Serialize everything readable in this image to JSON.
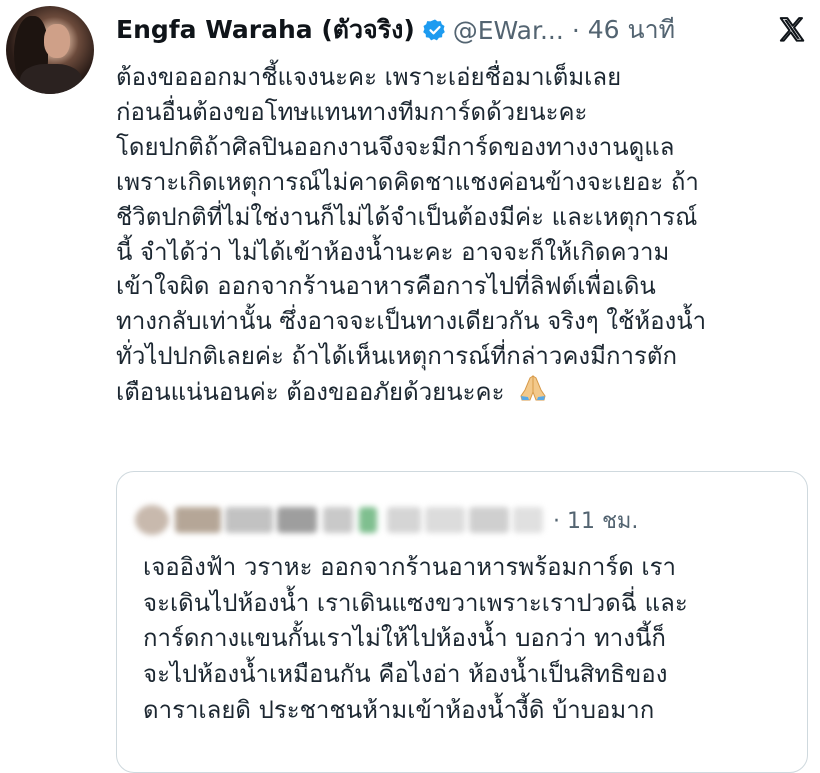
{
  "tweet": {
    "author_name": "Engfa Waraha (ตัวจริง)",
    "handle": "@EWar...",
    "separator": "·",
    "time": "46 นาที",
    "lines": [
      "ต้องขอออกมาชี้แจงนะคะ เพราะเอ่ยชื่อมาเต็มเลย",
      "ก่อนอื่นต้องขอโทษแทนทางทีมการ์ดด้วยนะคะ",
      "โดยปกติถ้าศิลปินออกงานจึงจะมีการ์ดของทางงานดูแล",
      "เพราะเกิดเหตุการณ์ไม่คาดคิดชาแชงค่อนข้างจะเยอะ ถ้า",
      "ชีวิตปกติที่ไม่ใช่งานก็ไม่ได้จำเป็นต้องมีค่ะ และเหตุการณ์",
      "นี้ จำได้ว่า ไม่ได้เข้าห้องน้ำนะคะ อาจจะก็ให้เกิดความ",
      "เข้าใจผิด  ออกจากร้านอาหารคือการไปที่ลิฟต์เพื่อเดิน",
      "ทางกลับเท่านั้น ซึ่งอาจจะเป็นทางเดียวกัน จริงๆ ใช้ห้องน้ำ",
      "ทั่วไปปกติเลยค่ะ  ถ้าได้เห็นเหตุการณ์ที่กล่าวคงมีการตัก",
      "เตือนแน่นอนค่ะ ต้องขออภัยด้วยนะคะ"
    ],
    "emoji_icon": "folded-hands-icon"
  },
  "quoted": {
    "time": "· 11 ชม.",
    "lines": [
      "เจออิงฟ้า วราหะ ออกจากร้านอาหารพร้อมการ์ด เรา",
      "จะเดินไปห้องน้ำ เราเดินแซงขวาเพราะเราปวดฉี่ และ",
      "การ์ดกางแขนกั้นเราไม่ให้ไปห้องน้ำ บอกว่า ทางนี้ก็",
      "จะไปห้องน้ำเหมือนกัน คือไงอ่า ห้องน้ำเป็นสิทธิของ",
      "ดาราเลยดิ ประชาชนห้ามเข้าห้องน้ำงี้ดิ บ้าบอมาก"
    ]
  },
  "icons": {
    "verified": "verified-badge-icon",
    "close": "x-logo-icon"
  },
  "colors": {
    "verified_blue": "#1d9bf0",
    "muted": "#536471",
    "text": "#0f1419",
    "border": "#cfd9de"
  }
}
